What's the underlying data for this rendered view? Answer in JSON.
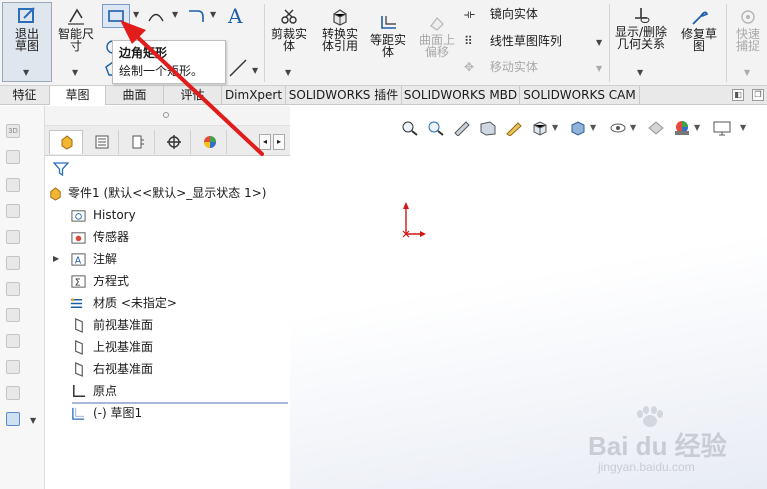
{
  "ribbon": {
    "exit_sketch": "退出草图",
    "smart_dimension": "智能尺寸",
    "tooltip_title": "边角矩形",
    "tooltip_desc": "绘制一个矩形。",
    "trim_entities": "剪裁实体",
    "convert_entities": "转换实体引用",
    "offset_entities": "等距实体",
    "surface_offset": "曲面上偏移",
    "mirror_entities": "镜向实体",
    "linear_pattern": "线性草图阵列",
    "move_entities": "移动实体",
    "display_relations": "显示/删除几何关系",
    "repair_sketch": "修复草图",
    "rapid_snap": "快速捕捉"
  },
  "tabs": [
    {
      "label": "特征"
    },
    {
      "label": "草图"
    },
    {
      "label": "曲面"
    },
    {
      "label": "评估"
    },
    {
      "label": "DimXpert"
    },
    {
      "label": "SOLIDWORKS 插件"
    },
    {
      "label": "SOLIDWORKS MBD"
    },
    {
      "label": "SOLIDWORKS CAM"
    }
  ],
  "tree": {
    "root": "零件1  (默认<<默认>_显示状态 1>)",
    "items": [
      {
        "label": "History",
        "icon": "history-icon"
      },
      {
        "label": "传感器",
        "icon": "sensor-icon"
      },
      {
        "label": "注解",
        "icon": "annotation-icon"
      },
      {
        "label": "方程式",
        "icon": "equation-icon"
      },
      {
        "label": "材质 <未指定>",
        "icon": "material-icon"
      },
      {
        "label": "前视基准面",
        "icon": "plane-icon"
      },
      {
        "label": "上视基准面",
        "icon": "plane-icon"
      },
      {
        "label": "右视基准面",
        "icon": "plane-icon"
      },
      {
        "label": "原点",
        "icon": "origin-icon"
      },
      {
        "label": "(-) 草图1",
        "icon": "sketch-icon"
      }
    ]
  },
  "watermark": {
    "brand": "Bai du 经验",
    "url": "jingyan.baidu.com"
  },
  "colors": {
    "accent_blue": "#2a6ebb",
    "arrow_red": "#e21b1b",
    "origin_red": "#d11616"
  }
}
